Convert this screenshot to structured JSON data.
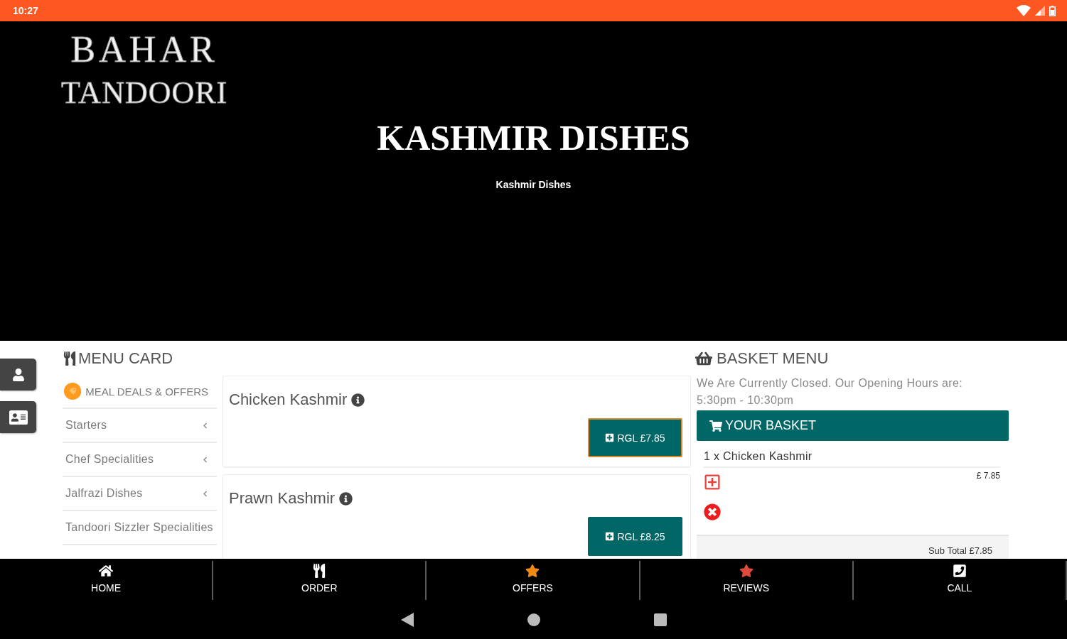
{
  "status_bar": {
    "time": "10:27"
  },
  "header": {
    "logo_lines": [
      "BAHAR",
      "TANDOORI"
    ],
    "title": "KASHMIR DISHES",
    "subtitle": "Kashmir Dishes"
  },
  "menu_card": {
    "title": "MENU CARD",
    "categories": [
      {
        "label": "MEAL DEALS & OFFERS",
        "kind": "offers"
      },
      {
        "label": "Starters",
        "kind": "submenu"
      },
      {
        "label": "Chef Specialities",
        "kind": "submenu"
      },
      {
        "label": "Jalfrazi Dishes",
        "kind": "submenu"
      },
      {
        "label": "Tandoori Sizzler Specialities",
        "kind": "plain"
      }
    ]
  },
  "dishes": [
    {
      "name": "Chicken Kashmir",
      "price_button": "RGL £7.85",
      "focused": true
    },
    {
      "name": "Prawn Kashmir",
      "price_button": "RGL £8.25",
      "focused": false
    }
  ],
  "basket": {
    "title": "BASKET MENU",
    "notice": [
      "We Are Currently Closed. Our Opening Hours are:",
      "5:30pm - 10:30pm"
    ],
    "heading": "YOUR BASKET",
    "items": [
      {
        "name": "1 x Chicken Kashmir",
        "price": "£ 7.85"
      }
    ],
    "subtotal": "Sub Total £7.85"
  },
  "bottom_nav": [
    {
      "label": "HOME",
      "kind": "home"
    },
    {
      "label": "ORDER",
      "kind": "order"
    },
    {
      "label": "OFFERS",
      "kind": "offers"
    },
    {
      "label": "REVIEWS",
      "kind": "reviews"
    },
    {
      "label": "CALL",
      "kind": "call"
    }
  ]
}
